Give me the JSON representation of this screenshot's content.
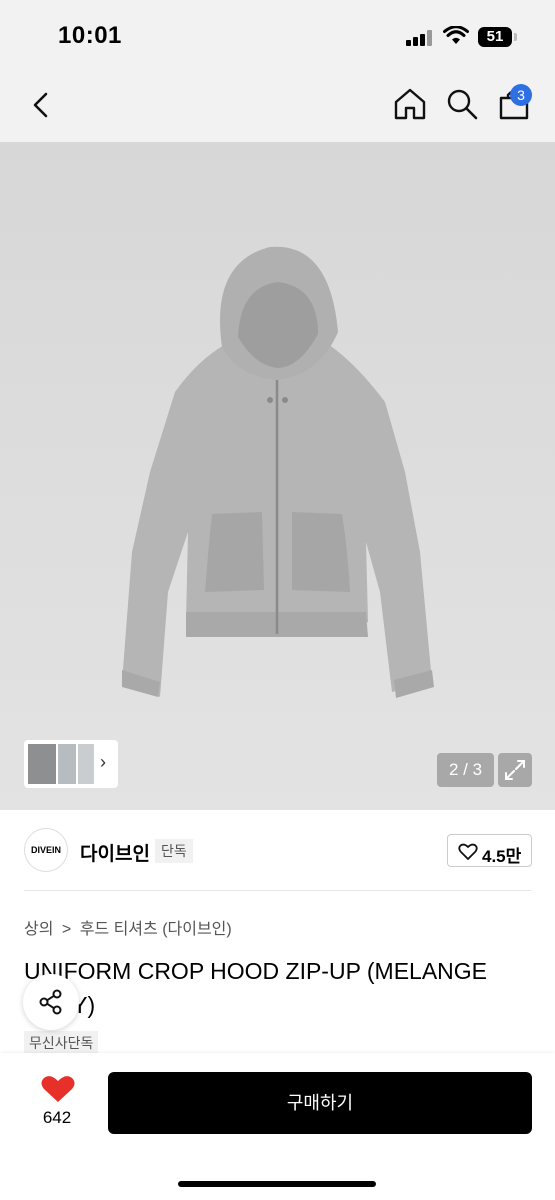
{
  "status_bar": {
    "time": "10:01",
    "battery": "51"
  },
  "nav": {
    "cart_count": "3"
  },
  "gallery": {
    "pager": "2 / 3"
  },
  "brand": {
    "logo_text": "DIVEIN",
    "name": "다이브인",
    "badge": "단독",
    "likes": "4.5만"
  },
  "breadcrumb": {
    "category": "상의",
    "separator": ">",
    "subcategory": "후드 티셔츠 (다이브인)"
  },
  "product": {
    "title": "UNIFORM CROP HOOD ZIP-UP (MELANGE GRAY)",
    "store_badge": "무신사단독"
  },
  "bottom_bar": {
    "heart_count": "642",
    "buy_label": "구매하기"
  },
  "colors": {
    "accent_blue": "#2f6fe4",
    "heart_red": "#e8302b",
    "buy_bg": "#000000",
    "hoodie_gray": "#b5b5b5"
  },
  "icons": [
    "back-icon",
    "home-icon",
    "search-icon",
    "cart-icon",
    "expand-icon",
    "share-icon",
    "heart-outline-icon",
    "heart-filled-icon"
  ]
}
